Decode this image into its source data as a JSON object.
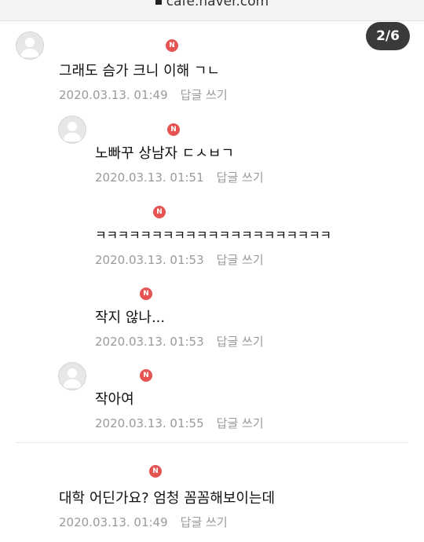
{
  "browser": {
    "url": "cafe.naver.com"
  },
  "pager": {
    "label": "2/6"
  },
  "comments": [
    {
      "text": "그래도 슴가 크니 이해 ㄱㄴ",
      "date": "2020.03.13. 01:49",
      "reply": "답글 쓰기",
      "badge": "N"
    },
    {
      "text": "노빠꾸 상남자 ㄷㅅㅂㄱ",
      "date": "2020.03.13. 01:51",
      "reply": "답글 쓰기",
      "badge": "N"
    },
    {
      "text": "ㅋㅋㅋㅋㅋㅋㅋㅋㅋㅋㅋㅋㅋㅋㅋㅋㅋㅋㅋㅋㅋ",
      "date": "2020.03.13. 01:53",
      "reply": "답글 쓰기",
      "badge": "N"
    },
    {
      "text": "작지 않나...",
      "date": "2020.03.13. 01:53",
      "reply": "답글 쓰기",
      "badge": "N"
    },
    {
      "text": "작아여",
      "date": "2020.03.13. 01:55",
      "reply": "답글 쓰기",
      "badge": "N"
    },
    {
      "text": "대학 어딘가요? 엄청 꼼꼼해보이는데",
      "date": "2020.03.13. 01:49",
      "reply": "답글 쓰기",
      "badge": "N"
    }
  ],
  "colors": {
    "badge": "#e55353",
    "meta": "#9a9a9a",
    "pager_bg": "#3a3a3a"
  }
}
